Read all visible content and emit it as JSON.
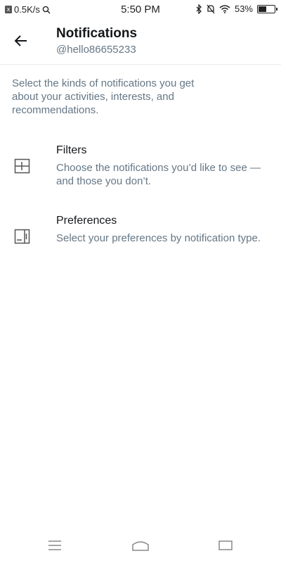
{
  "status_bar": {
    "network_speed": "0.5K/s",
    "time": "5:50 PM",
    "battery": "53%",
    "battery_level": 0.53
  },
  "header": {
    "title": "Notifications",
    "handle": "@hello86655233"
  },
  "intro": "Select the kinds of notifications you get about your activities, interests, and recommendations.",
  "rows": [
    {
      "title": "Filters",
      "description": "Choose the notifications you’d like to see — and those you don’t.",
      "icon": "filter-icon"
    },
    {
      "title": "Preferences",
      "description": "Select your preferences by notification type.",
      "icon": "preferences-icon"
    }
  ],
  "nav_bar": {
    "icons": [
      "menu-icon",
      "home-icon",
      "recents-icon"
    ]
  }
}
